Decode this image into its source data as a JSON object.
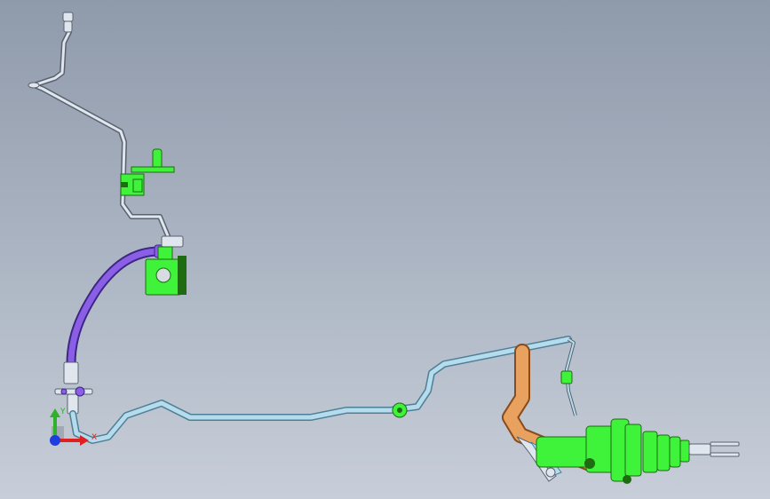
{
  "viewport": {
    "background_top": "#8f9aab",
    "background_bottom": "#c7ced9"
  },
  "colors": {
    "metal_tube": "#dfe6ee",
    "metal_outline": "#5a6270",
    "light_blue_tube": "#b5dcec",
    "light_blue_outline": "#4f7f96",
    "purple_hose": "#8a5fe6",
    "purple_outline": "#3c2585",
    "green_part": "#3ff23a",
    "green_outline": "#1e6b12",
    "copper_pipe": "#e8a15e",
    "copper_outline": "#8a4a1a",
    "axis_x": "#e0201e",
    "axis_y": "#2fb12a",
    "axis_z": "#1e3fe0"
  },
  "triad": {
    "x_label": "X",
    "y_label": "Y"
  }
}
